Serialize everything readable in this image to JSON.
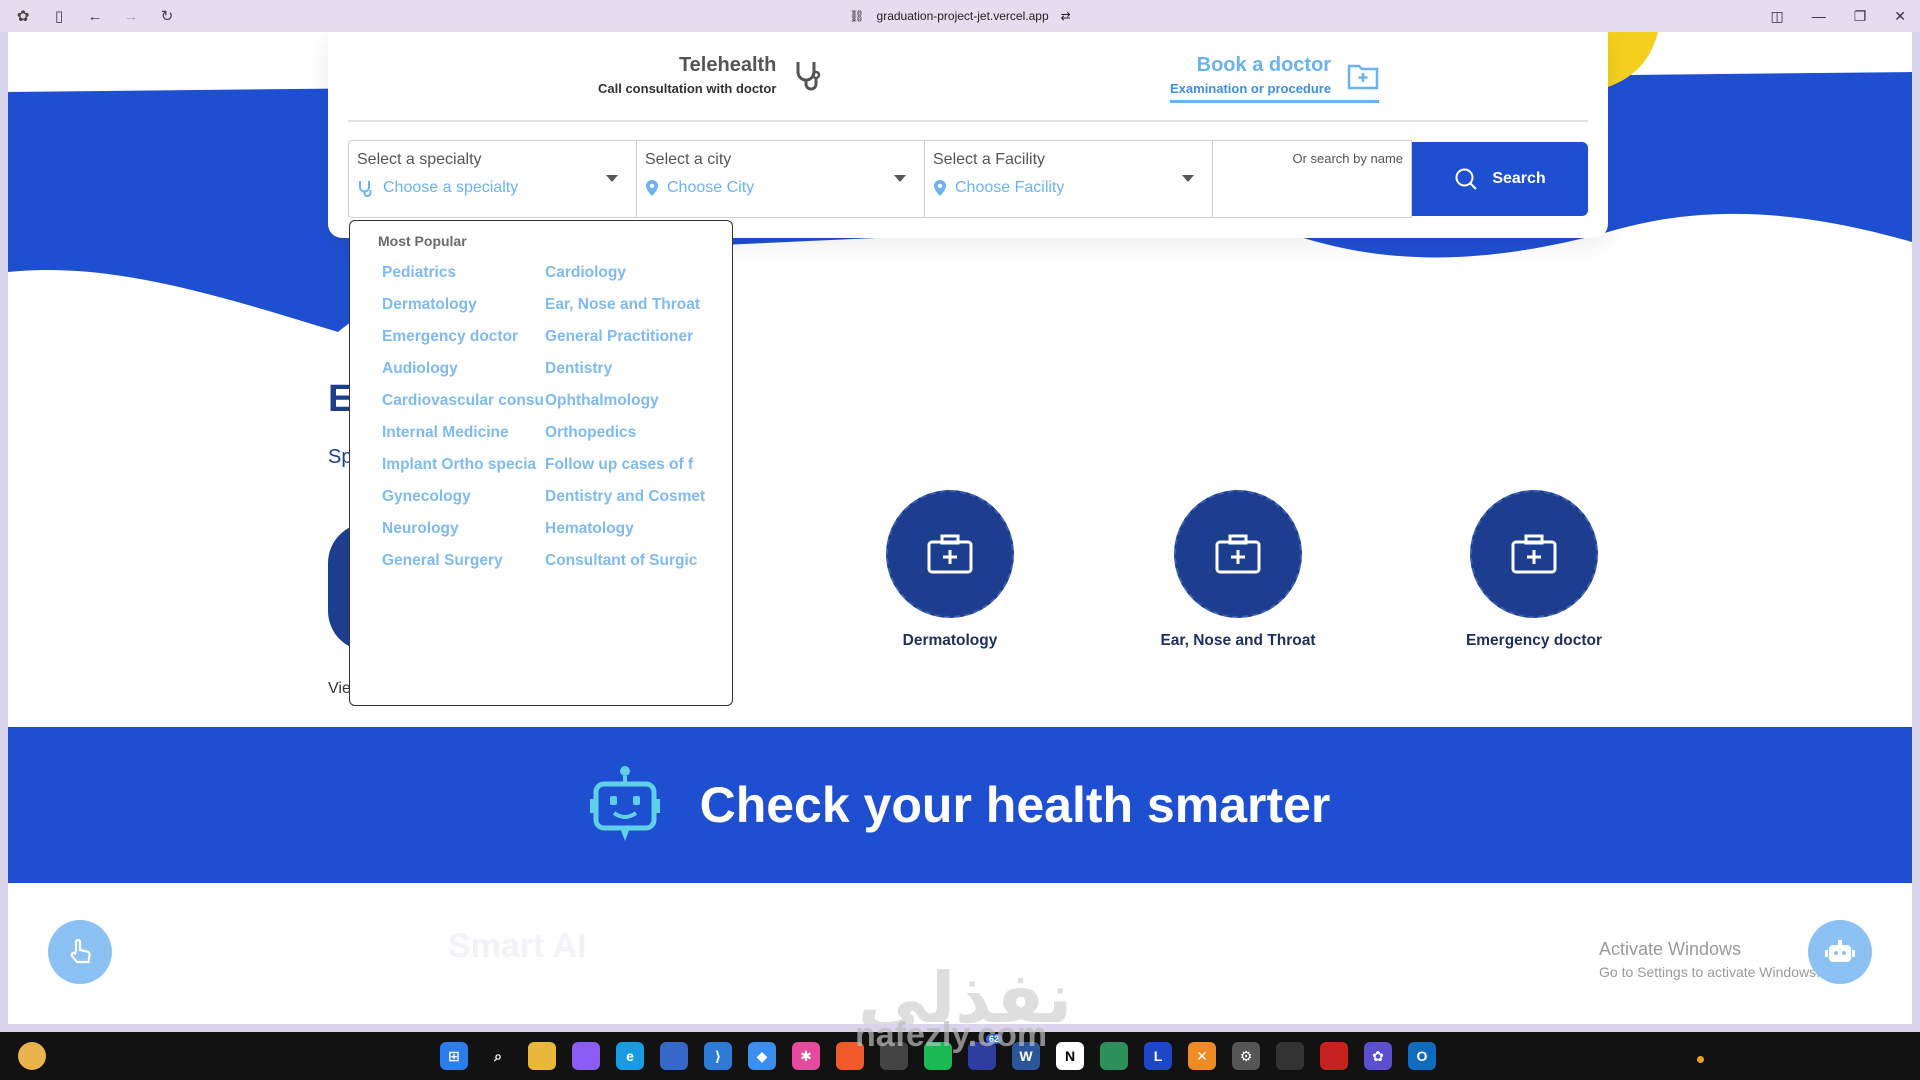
{
  "browser": {
    "url": "graduation-project-jet.vercel.app"
  },
  "tabs": {
    "telehealth": {
      "title": "Telehealth",
      "subtitle": "Call consultation with doctor"
    },
    "book": {
      "title": "Book a doctor",
      "subtitle": "Examination or procedure"
    }
  },
  "filters": {
    "specialty": {
      "label": "Select a specialty",
      "value": "Choose a specialty"
    },
    "city": {
      "label": "Select a city",
      "value": "Choose City"
    },
    "facility": {
      "label": "Select a Facility",
      "value": "Choose Facility"
    },
    "name": {
      "hint": "Or search by name"
    },
    "search_label": "Search"
  },
  "dropdown": {
    "heading": "Most Popular",
    "items": [
      "Pediatrics",
      "Cardiology",
      "Dermatology",
      "Ear, Nose and Throat",
      "Emergency doctor",
      "General Practitioner",
      "Audiology",
      "Dentistry",
      "Cardiovascular consu",
      "Ophthalmology",
      "Internal Medicine",
      "Orthopedics",
      "Implant Ortho specia",
      "Follow up cases of f",
      "Gynecology",
      "Dentistry and Cosmet",
      "Neurology",
      "Hematology",
      "General Surgery",
      "Consultant of Surgic"
    ]
  },
  "section": {
    "heading": "E",
    "sub": "Sp",
    "view": "Vie",
    "specialties": [
      "Dermatology",
      "Ear, Nose and Throat",
      "Emergency doctor"
    ]
  },
  "banner": {
    "title": "Check your health smarter"
  },
  "below": {
    "title": "Smart AI"
  },
  "windows": {
    "line1": "Activate Windows",
    "line2": "Go to Settings to activate Windows."
  },
  "watermark": {
    "arabic": "نفذلي",
    "latin": "nafezly.com"
  },
  "taskbar": {
    "badge": "62"
  },
  "colors": {
    "primary": "#1f4fd1",
    "navy": "#1d3e8f",
    "light_blue": "#6ab3f0"
  }
}
